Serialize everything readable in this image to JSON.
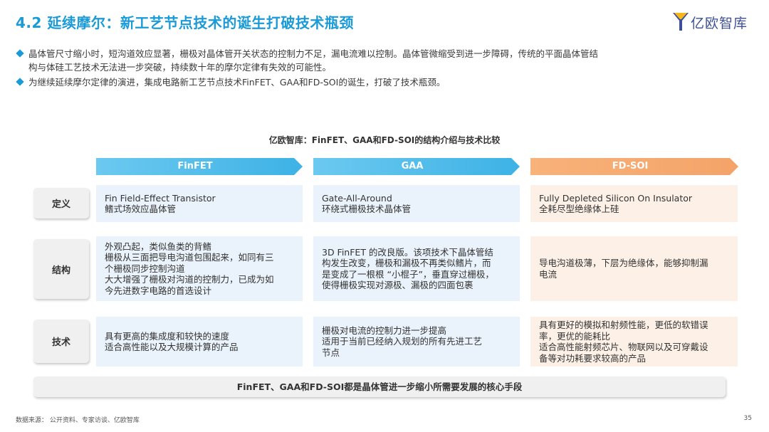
{
  "header": {
    "title": "4.2 延续摩尔：新工艺节点技术的诞生打破技术瓶颈",
    "logo_text": "亿欧智库"
  },
  "bullets": [
    {
      "lines": [
        "晶体管尺寸缩小时，短沟道效应显著，栅极对晶体管开关状态的控制力不足，漏电流难以控制。晶体管微缩受到进一步障碍，传统的平面晶体管结",
        "构与体硅工艺技术无法进一步突破，持续数十年的摩尔定律有失效的可能性。"
      ]
    },
    {
      "lines": [
        "为继续延续摩尔定律的演进，集成电路新工艺节点技术FinFET、GAA和FD-SOI的诞生，打破了技术瓶颈。"
      ]
    }
  ],
  "table": {
    "title": "亿欧智库：FinFET、GAA和FD-SOI的结构介绍与技术比较",
    "columns": [
      "FinFET",
      "GAA",
      "FD-SOI"
    ],
    "rows": [
      {
        "label": "定义",
        "cells": [
          [
            "Fin Field-Effect Transistor",
            "鳍式场效应晶体管"
          ],
          [
            "Gate-All-Around",
            "环绕式栅极技术晶体管"
          ],
          [
            "Fully Depleted Silicon On Insulator",
            "全耗尽型绝缘体上硅"
          ]
        ]
      },
      {
        "label": "结构",
        "cells": [
          [
            "外观凸起，类似鱼类的背鳍",
            "栅极从三面把导电沟道包围起来，如同有三",
            "个栅极同步控制沟道",
            "大大增强了栅极对沟道的控制力，已成为如",
            "今先进数字电路的首选设计"
          ],
          [
            "3D FinFET 的改良版。该项技术下晶体管结",
            "构发生改变，栅极和漏极不再类似鳍片，而",
            "是变成了一根根 “小棍子”，垂直穿过栅极，",
            "使得栅极实现对源极、漏极的四面包裹"
          ],
          [
            "导电沟道极薄，下层为绝缘体，能够抑制漏",
            "电流"
          ]
        ]
      },
      {
        "label": "技术",
        "cells": [
          [
            "具有更高的集成度和较快的速度",
            "适合高性能以及大规模计算的产品"
          ],
          [
            "栅极对电流的控制力进一步提高",
            "适用于当前已经纳入规划的所有先进工艺",
            "节点"
          ],
          [
            "具有更好的模拟和射频性能，更低的软错误",
            "率，更优的能耗比",
            "适合高性能射频芯片、物联网以及可穿戴设",
            "备等对功耗要求较高的产品"
          ]
        ]
      }
    ],
    "summary": "FinFET、GAA和FD-SOI都是晶体管进一步缩小所需要发展的核心手段"
  },
  "footer": {
    "source": "数据来源： 公开资料、专家访谈、亿欧智库",
    "page_number": "35"
  },
  "colors": {
    "accent_blue": "#1a9ad7",
    "header_blue": "#3fb3e6",
    "header_orange": "#f4a469",
    "cell_blue": "#eaf3fb",
    "cell_orange": "#fdf0e6",
    "logo_blue": "#3c4f98",
    "logo_yellow": "#f4b81c"
  }
}
